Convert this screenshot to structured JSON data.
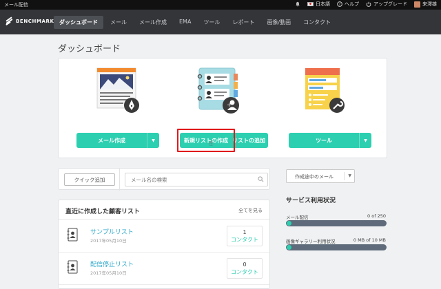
{
  "topbar": {
    "title": "メール配信",
    "items": [
      {
        "icon": "bell-icon",
        "label": ""
      },
      {
        "icon": "japan-flag-icon",
        "label": "日本語"
      },
      {
        "icon": "help-circle-icon",
        "label": "ヘルプ"
      },
      {
        "icon": "power-icon",
        "label": "アップグレード"
      },
      {
        "icon": "user-avatar",
        "label": "来澤雄"
      }
    ]
  },
  "navbar": {
    "logo": "BENCHMARK",
    "items": [
      "ダッシュボード",
      "メール",
      "メール作成",
      "EMA",
      "ツール",
      "レポート",
      "画像/動画",
      "コンタクト"
    ],
    "active_index": 0
  },
  "page": {
    "title": "ダッシュボード"
  },
  "features": [
    {
      "button": "メール作成",
      "illustration": "email-editor-illustration"
    },
    {
      "button_left": "新規リストの作成",
      "button_right": "リストの追加",
      "illustration": "contact-book-illustration"
    },
    {
      "button": "ツール",
      "illustration": "tools-form-illustration"
    }
  ],
  "quick": {
    "button": "クイック追加",
    "search_placeholder": "メール名の検索"
  },
  "recent_lists": {
    "title": "直近に作成した顧客リスト",
    "see_all": "全てを見る",
    "rows": [
      {
        "name": "サンプルリスト",
        "date": "2017年05月10日",
        "count": "1",
        "count_label": "コンタクト"
      },
      {
        "name": "配信停止リスト",
        "date": "2017年05月10日",
        "count": "0",
        "count_label": "コンタクト"
      }
    ]
  },
  "drafts": {
    "label": "作成途中のメール"
  },
  "usage": {
    "title": "サービス利用状況",
    "items": [
      {
        "label": "メール配信",
        "value": "0 of 250",
        "fraction": 0
      },
      {
        "label": "画像ギャラリー利用状況",
        "value": "0 MB of 10 MB",
        "fraction": 0
      }
    ]
  },
  "colors": {
    "accent": "#2ccfb0",
    "nav_bg": "#333538",
    "highlight": "#e0191c",
    "link": "#2aa7c8"
  }
}
